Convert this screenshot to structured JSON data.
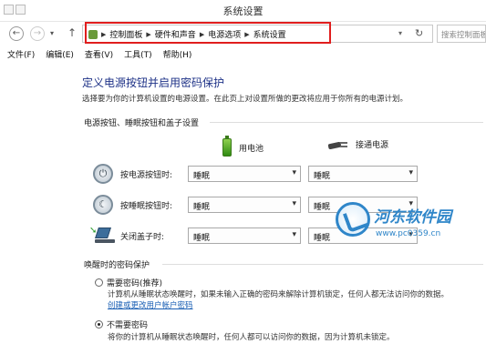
{
  "window": {
    "title": "系统设置"
  },
  "address_bar": {
    "crumbs": [
      "控制面板",
      "硬件和声音",
      "电源选项",
      "系统设置"
    ],
    "search_placeholder": "搜索控制面板"
  },
  "menu": [
    "文件(F)",
    "编辑(E)",
    "查看(V)",
    "工具(T)",
    "帮助(H)"
  ],
  "page": {
    "heading": "定义电源按钮并启用密码保护",
    "description": "选择要为你的计算机设置的电源设置。在此页上对设置所做的更改将应用于你所有的电源计划。",
    "section_buttons": "电源按钮、睡眠按钮和盖子设置",
    "col_battery": "用电池",
    "col_ac": "接通电源",
    "rows": [
      {
        "label": "按电源按钮时:",
        "battery": "睡眠",
        "ac": "睡眠"
      },
      {
        "label": "按睡眠按钮时:",
        "battery": "睡眠",
        "ac": "睡眠"
      },
      {
        "label": "关闭盖子时:",
        "battery": "睡眠",
        "ac": "睡眠"
      }
    ],
    "section_password": "唤醒时的密码保护",
    "options": [
      {
        "label": "需要密码(推荐)",
        "description": "计算机从睡眠状态唤醒时，如果未输入正确的密码来解除计算机锁定，任何人都无法访问你的数据。",
        "link": "创建或更改用户帐户密码",
        "selected": false
      },
      {
        "label": "不需要密码",
        "description": "将你的计算机从睡眠状态唤醒时，任何人都可以访问你的数据，因为计算机未锁定。",
        "selected": true
      }
    ]
  },
  "watermark": {
    "name": "河东软件园",
    "url": "www.pc0359.cn"
  }
}
